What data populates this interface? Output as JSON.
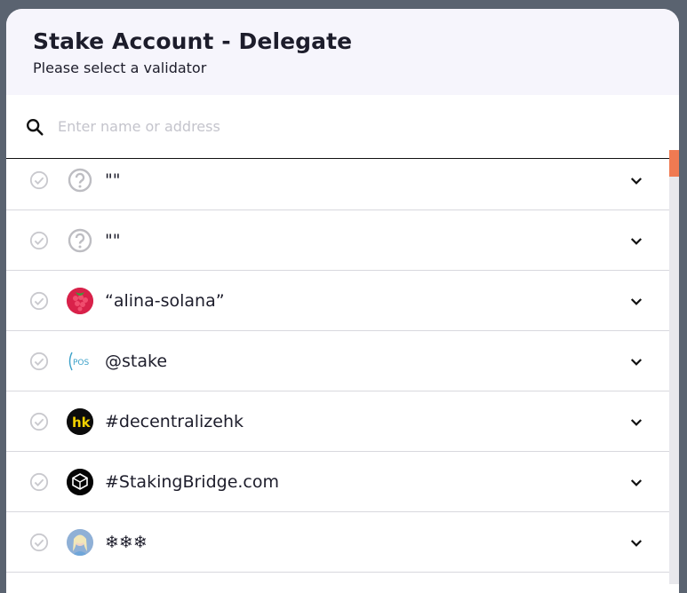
{
  "modal": {
    "title": "Stake Account - Delegate",
    "subtitle": "Please select a validator"
  },
  "search": {
    "placeholder": "Enter name or address",
    "icon": "search-icon"
  },
  "validators": [
    {
      "name": "\"\"",
      "avatar": "question-icon"
    },
    {
      "name": "\"\"",
      "avatar": "question-icon"
    },
    {
      "name": "“alina-solana”",
      "avatar": "raspberry-avatar"
    },
    {
      "name": "@stake",
      "avatar": "pos-avatar",
      "avatar_text": "POS"
    },
    {
      "name": "#decentralizehk",
      "avatar": "hk-avatar",
      "avatar_text": "hk"
    },
    {
      "name": "#StakingBridge.com",
      "avatar": "stakingbridge-avatar"
    },
    {
      "name": "❄❄❄",
      "avatar": "elsa-avatar"
    }
  ],
  "colors": {
    "accent": "#f07a52",
    "header_bg": "#f6f5fc",
    "text": "#1d1d2b",
    "check": "#c9c9ce"
  }
}
